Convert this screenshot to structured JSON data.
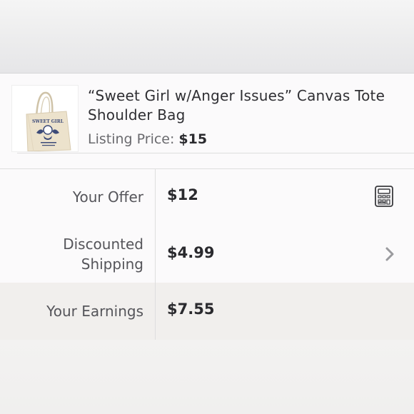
{
  "product": {
    "title": "“Sweet Girl w/Anger Issues” Canvas Tote Shoulder Bag",
    "listing_label": "Listing Price:",
    "listing_price": "$15",
    "image_icon": "tote-bag-image",
    "bag_print_text": "SWEET GIRL"
  },
  "offer": {
    "label": "Your Offer",
    "value": "$12",
    "icon": "calculator-icon"
  },
  "shipping": {
    "label_line1": "Discounted",
    "label_line2": "Shipping",
    "value": "$4.99",
    "icon": "chevron-right-icon"
  },
  "earnings": {
    "label": "Your Earnings",
    "value": "$7.55"
  },
  "colors": {
    "text_primary": "#2a2a2e",
    "text_secondary": "#6a6a6e",
    "divider": "#dedede",
    "earnings_bg": "#f1efed"
  }
}
